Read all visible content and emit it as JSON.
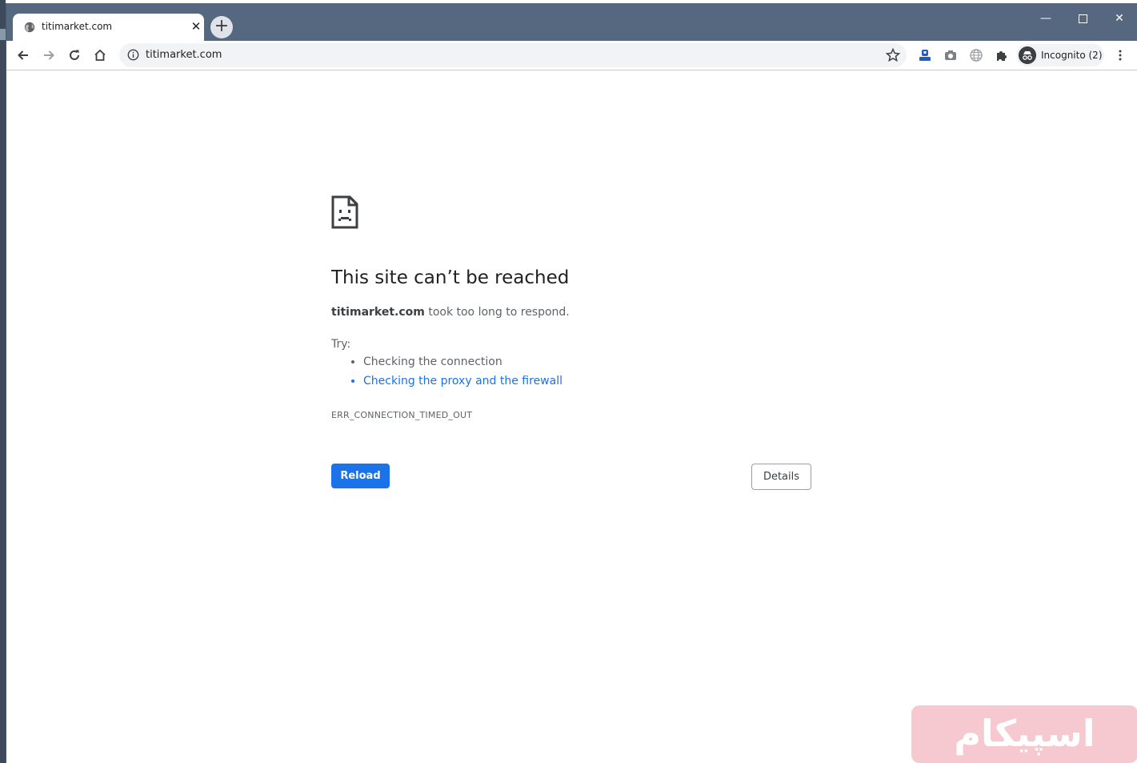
{
  "browser": {
    "tab": {
      "title": "titimarket.com"
    },
    "new_tab_label": "+",
    "url": "titimarket.com",
    "profile_label": "Incognito (2)"
  },
  "error_page": {
    "heading": "This site can’t be reached",
    "host": "titimarket.com",
    "message": " took too long to respond.",
    "try_label": "Try:",
    "suggestions": [
      {
        "label": "Checking the connection"
      },
      {
        "label": "Checking the proxy and the firewall"
      }
    ],
    "error_code": "ERR_CONNECTION_TIMED_OUT",
    "reload_label": "Reload",
    "details_label": "Details"
  },
  "watermark": {
    "text": "اسپیکام"
  },
  "colors": {
    "titlebar": "#56687f",
    "primary_button": "#1a73e8",
    "link": "#1a73e8",
    "watermark_bg": "#f6c9d0"
  }
}
